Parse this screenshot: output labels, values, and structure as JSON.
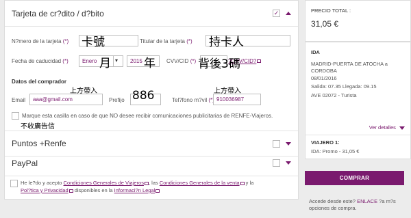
{
  "card": {
    "title": "Tarjeta de cr?dito / d?bito",
    "number_label": "N?mero de la tarjeta",
    "number_hand": "卡號",
    "holder_label": "Titular de la tarjeta",
    "holder_hand": "持卡人",
    "expiry_label": "Fecha de caducidad",
    "month_value": "Enero",
    "month_hand": "月",
    "year_value": "2015",
    "year_hand": "年",
    "cvv_label": "CVV/CID",
    "cvv_link": "?CVV/CID?",
    "cvv_hand": "背後3碼",
    "req": "(*)"
  },
  "buyer": {
    "heading": "Datos del comprador",
    "email_label": "Email",
    "email_value": "aaa@gmail.com",
    "email_hand": "上方帶入",
    "prefix_label": "Prefijo",
    "prefix_hand": "886",
    "phone_label": "Tel?fono m?vil",
    "phone_value": "910036987",
    "phone_hand": "上方帶入",
    "optout_text": "Marque esta casilla en caso de que NO desee recibir comunicaciones publicitarias de RENFE-Viajeros.",
    "optout_hand": "不收廣告信"
  },
  "sections": {
    "puntos": "Puntos +Renfe",
    "paypal": "PayPal"
  },
  "terms": {
    "p1": "He le?do y acepto ",
    "l1": "Condiciones Generales de Viajeros",
    "p2": ", las ",
    "l2": "Condiciones Generales de la venta",
    "p3": " y la",
    "l3": "Pol?tica y Privacidad",
    "p4": " disponibles en la ",
    "l4": "Informaci?n Legal"
  },
  "summary": {
    "total_label": "PRECIO TOTAL :",
    "total_value": "31,05 €",
    "ida_label": "IDA",
    "route": "MADRID-PUERTA DE ATOCHA a CORDOBA",
    "date": "08/01/2016",
    "times": "Salida: 07.35 Llegada: 09.15",
    "train": "AVE 02072 - Turista",
    "details_link": "Ver detalles",
    "viajero_label": "VIAJERO 1:",
    "viajero_value": "IDA: Promo - 31,05 €",
    "buy_label": "COMPRAR",
    "footer_p1": "Accede desde este? ",
    "footer_link": "ENLACE",
    "footer_p2": " ?a m?s opciones de compra."
  }
}
